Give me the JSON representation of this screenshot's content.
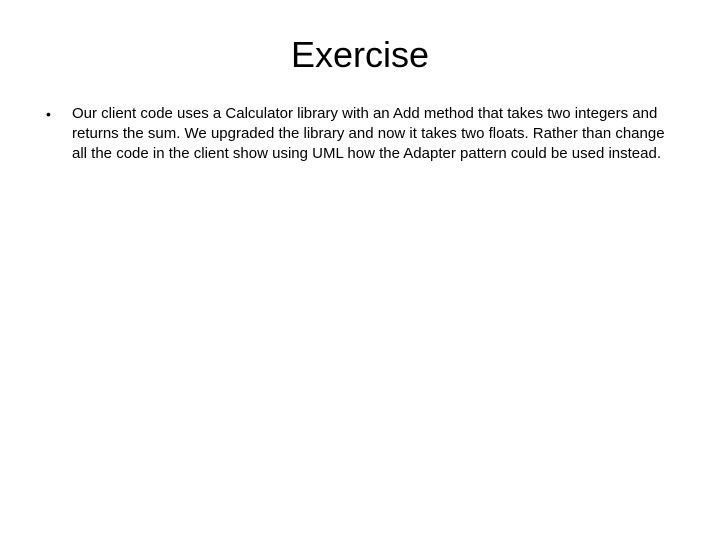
{
  "slide": {
    "title": "Exercise",
    "bullets": [
      {
        "marker": "•",
        "text": "Our client code uses a Calculator library with an Add method that takes two integers and returns the sum.  We upgraded the library and now it takes two floats.  Rather than change all the code in the client show using UML how the Adapter pattern could be used instead."
      }
    ]
  }
}
